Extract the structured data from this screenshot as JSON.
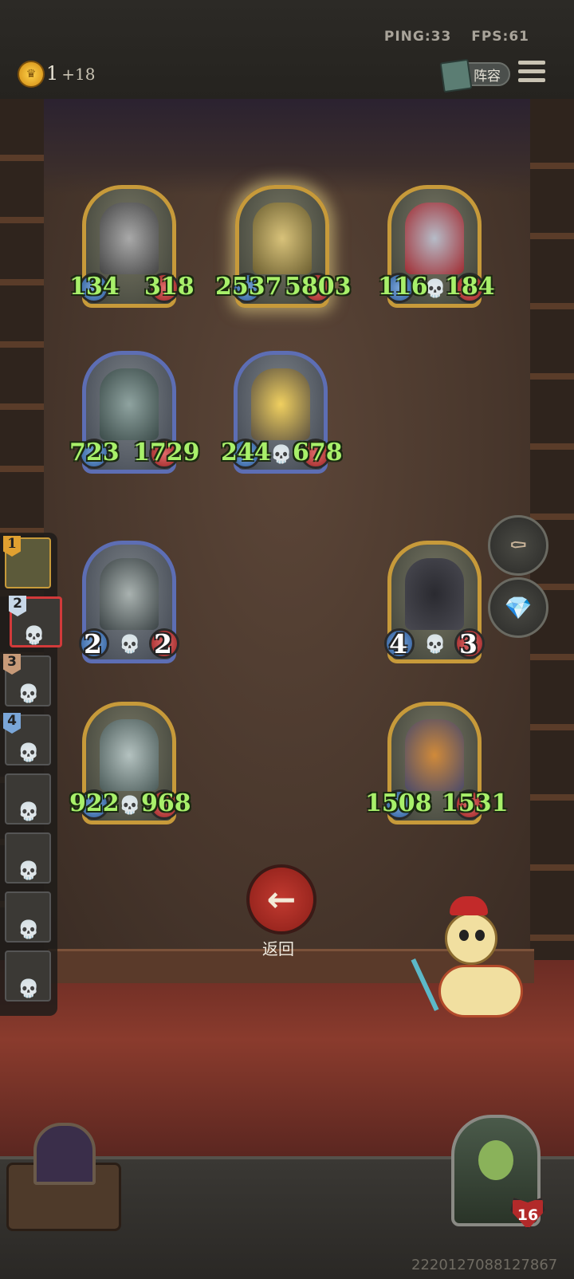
{
  "topbar": {
    "ping": "PING:33",
    "fps": "FPS:61",
    "gold_amount": "1",
    "gold_income": "+18",
    "lineup_label": "阵容"
  },
  "board": {
    "units": [
      {
        "name": "knight",
        "attack": "134",
        "health": "318",
        "frame": "gold"
      },
      {
        "name": "golem-mech",
        "attack": "2537",
        "health": "5803",
        "frame": "gold"
      },
      {
        "name": "vampire-lady",
        "attack": "116",
        "health": "184",
        "frame": "gold"
      },
      {
        "name": "shark-brute",
        "attack": "723",
        "health": "1729",
        "frame": "blue"
      },
      {
        "name": "gold-robot",
        "attack": "244",
        "health": "678",
        "frame": "blue"
      },
      {
        "name": "dome-robot",
        "attack": "2",
        "health": "2",
        "frame": "blue"
      },
      {
        "name": "hooded-reaper",
        "attack": "4",
        "health": "3",
        "frame": "gold"
      },
      {
        "name": "nun-priest",
        "attack": "922",
        "health": "968",
        "frame": "gold"
      },
      {
        "name": "pumpkin-head",
        "attack": "1508",
        "health": "1531",
        "frame": "gold"
      }
    ]
  },
  "sidebar": {
    "ranks": [
      "1",
      "2",
      "3",
      "4"
    ]
  },
  "back_label": "返回",
  "hero": {
    "health": "16"
  },
  "seed": "2220127088127867"
}
